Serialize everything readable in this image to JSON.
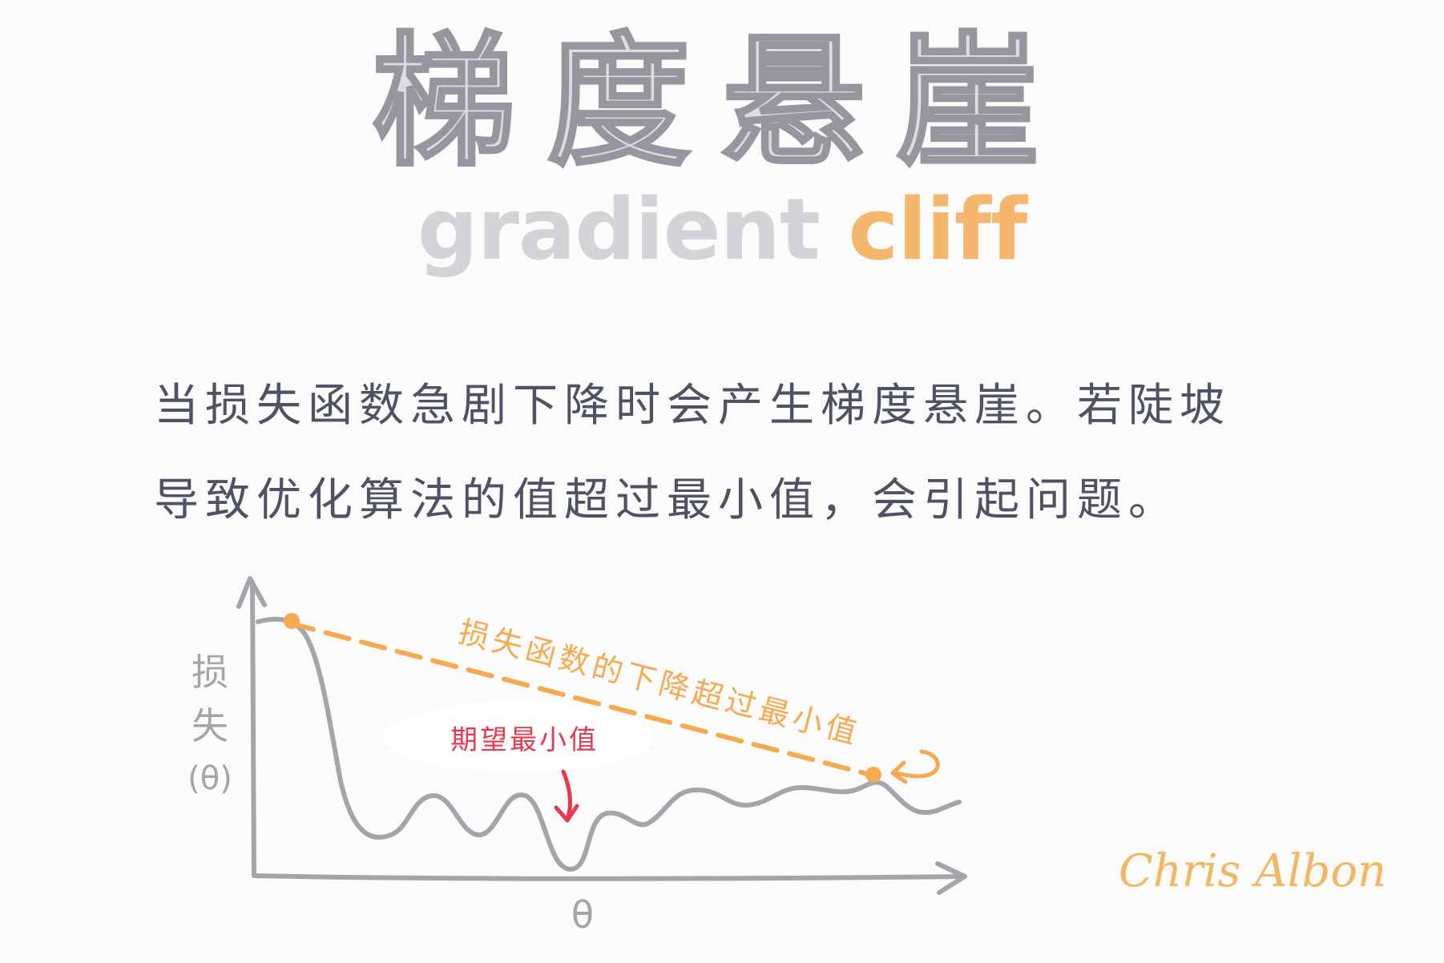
{
  "title": {
    "chinese": "梯度悬崖",
    "english_part1": "gradient",
    "english_part2": "cliff"
  },
  "description": {
    "line1": "当损失函数急剧下降时会产生梯度悬崖。若陡坡",
    "line2": "导致优化算法的值超过最小值，会引起问题。"
  },
  "diagram": {
    "y_axis_label_chars": [
      "损",
      "失",
      "(θ)"
    ],
    "x_axis_label": "θ",
    "desired_min_label": "期望最小值",
    "overshoot_label": "损失函数的下降超过最小值"
  },
  "signature": "Chris Albon",
  "colors": {
    "title_fill": "#dcdce3",
    "title_outline": "#96969e",
    "accent_orange": "#f6a94f",
    "desired_min_red": "#e8374e",
    "curve_gray": "#a3a5aa",
    "text_dark": "#4f5262"
  }
}
